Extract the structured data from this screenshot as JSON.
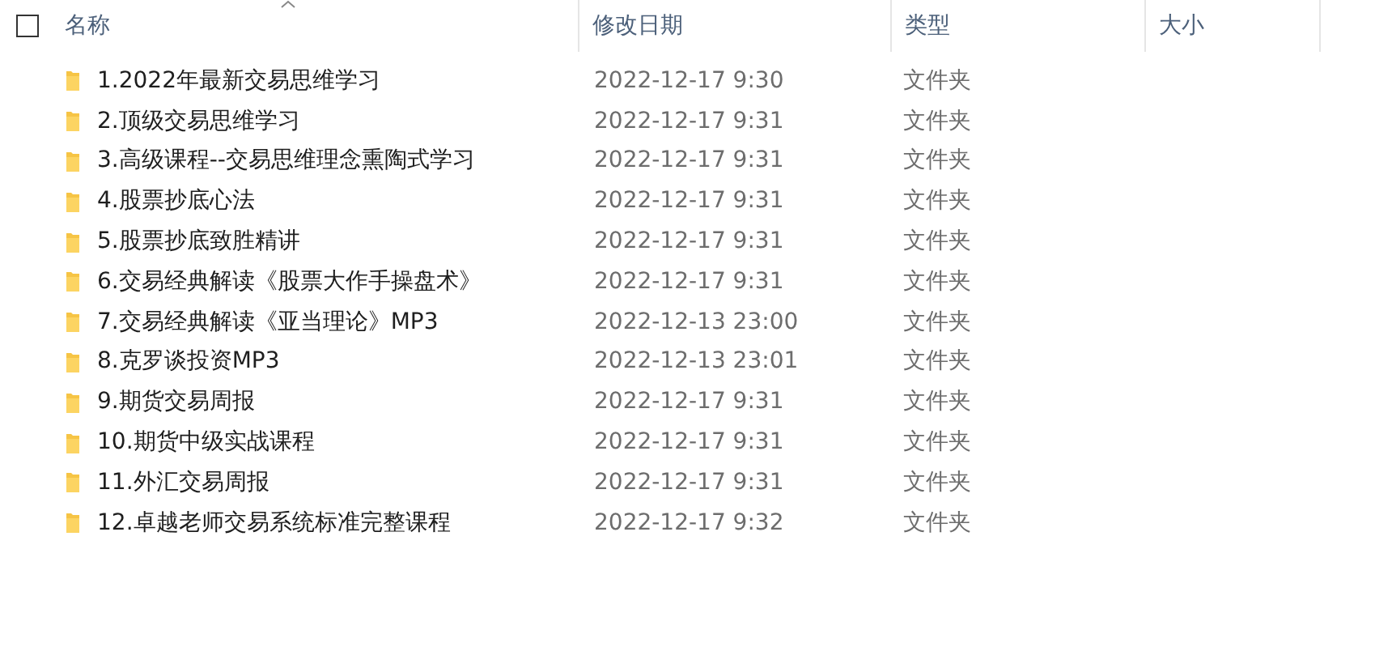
{
  "header": {
    "select_all_checked": false,
    "columns": [
      {
        "label": "名称",
        "sorted": true
      },
      {
        "label": "修改日期",
        "sorted": false
      },
      {
        "label": "类型",
        "sorted": false
      },
      {
        "label": "大小",
        "sorted": false
      }
    ]
  },
  "rows": [
    {
      "name": "1.2022年最新交易思维学习",
      "date": "2022-12-17 9:30",
      "type": "文件夹"
    },
    {
      "name": "2.顶级交易思维学习",
      "date": "2022-12-17 9:31",
      "type": "文件夹"
    },
    {
      "name": "3.高级课程--交易思维理念熏陶式学习",
      "date": "2022-12-17 9:31",
      "type": "文件夹"
    },
    {
      "name": "4.股票抄底心法",
      "date": "2022-12-17 9:31",
      "type": "文件夹"
    },
    {
      "name": "5.股票抄底致胜精讲",
      "date": "2022-12-17 9:31",
      "type": "文件夹"
    },
    {
      "name": "6.交易经典解读《股票大作手操盘术》",
      "date": "2022-12-17 9:31",
      "type": "文件夹"
    },
    {
      "name": "7.交易经典解读《亚当理论》MP3",
      "date": "2022-12-13 23:00",
      "type": "文件夹"
    },
    {
      "name": "8.克罗谈投资MP3",
      "date": "2022-12-13 23:01",
      "type": "文件夹"
    },
    {
      "name": "9.期货交易周报",
      "date": "2022-12-17 9:31",
      "type": "文件夹"
    },
    {
      "name": "10.期货中级实战课程",
      "date": "2022-12-17 9:31",
      "type": "文件夹"
    },
    {
      "name": "11.外汇交易周报",
      "date": "2022-12-17 9:31",
      "type": "文件夹"
    },
    {
      "name": "12.卓越老师交易系统标准完整课程",
      "date": "2022-12-17 9:32",
      "type": "文件夹"
    }
  ]
}
